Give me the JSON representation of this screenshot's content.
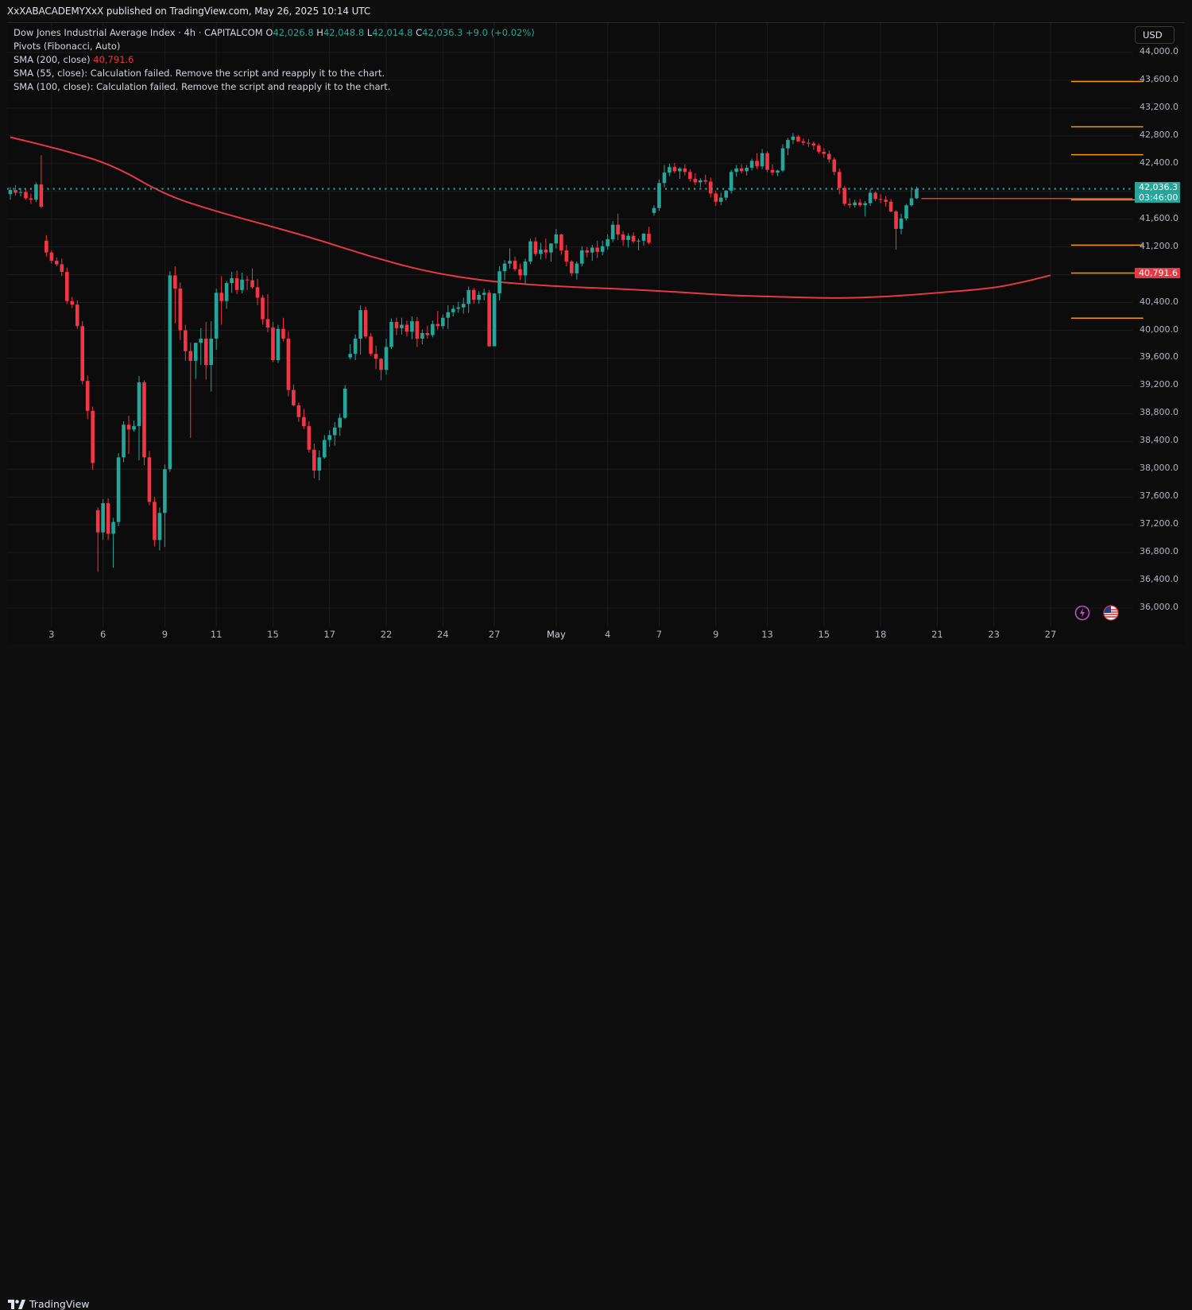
{
  "header": {
    "publish_line": "XxXABACADEMYXxX published on TradingView.com, May 26, 2025 10:14 UTC"
  },
  "legend": {
    "symbol_line": {
      "name": "Dow Jones Industrial Average Index · 4h · CAPITALCOM",
      "o_label": "O",
      "o": "42,026.8",
      "h_label": "H",
      "h": "42,048.8",
      "l_label": "L",
      "l": "42,014.8",
      "c_label": "C",
      "c": "42,036.3",
      "chg": "+9.0 (+0.02%)"
    },
    "pivots": "Pivots (Fibonacci, Auto)",
    "sma200_label": "SMA (200, close)",
    "sma200_value": "40,791.6",
    "sma55": "SMA (55, close): Calculation failed. Remove the script and reapply it to the chart.",
    "sma100": "SMA (100, close): Calculation failed. Remove the script and reapply it to the chart."
  },
  "currency_button": "USD",
  "price_tags": {
    "last": "42,036.3",
    "countdown": "03:46:00",
    "sma": "40,791.6"
  },
  "footer": {
    "brand": "TradingView"
  },
  "colors": {
    "up": "#26a69a",
    "down": "#f23645",
    "sma": "#e53946",
    "pivot": "#ff9800",
    "last_line": "#26a69a"
  },
  "chart_data": {
    "type": "candlestick",
    "title": "Dow Jones Industrial Average Index · 4h · CAPITALCOM",
    "ylim": [
      35750,
      44250
    ],
    "y_ticks": [
      "44,000.0",
      "43,600.0",
      "43,200.0",
      "42,800.0",
      "42,400.0",
      "42,000.0",
      "41,600.0",
      "41,200.0",
      "40,800.0",
      "40,400.0",
      "40,000.0",
      "39,600.0",
      "39,200.0",
      "38,800.0",
      "38,400.0",
      "38,000.0",
      "37,600.0",
      "37,200.0",
      "36,800.0",
      "36,400.0",
      "36,000.0"
    ],
    "y_tick_values": [
      44000,
      43600,
      43200,
      42800,
      42400,
      42000,
      41600,
      41200,
      40800,
      40400,
      40000,
      39600,
      39200,
      38800,
      38400,
      38000,
      37600,
      37200,
      36800,
      36400,
      36000
    ],
    "x_ticks": [
      "3",
      "6",
      "9",
      "11",
      "15",
      "17",
      "22",
      "24",
      "27",
      "May",
      "4",
      "7",
      "9",
      "13",
      "15",
      "18",
      "21",
      "23",
      "27"
    ],
    "x_tick_bars": [
      8,
      18,
      30,
      40,
      51,
      62,
      73,
      84,
      94,
      106,
      116,
      126,
      137,
      147,
      158,
      169,
      180,
      191,
      202
    ],
    "last_price": 42036.3,
    "sma200_last": 40791.6,
    "pivot_levels": [
      43582,
      42930,
      42528,
      41878,
      41226,
      40824,
      40174
    ],
    "sma200": [
      [
        0,
        42780
      ],
      [
        10,
        42600
      ],
      [
        20,
        42380
      ],
      [
        30,
        41950
      ],
      [
        40,
        41710
      ],
      [
        50,
        41510
      ],
      [
        60,
        41300
      ],
      [
        70,
        41060
      ],
      [
        80,
        40860
      ],
      [
        90,
        40730
      ],
      [
        100,
        40660
      ],
      [
        110,
        40620
      ],
      [
        120,
        40590
      ],
      [
        130,
        40550
      ],
      [
        140,
        40500
      ],
      [
        150,
        40480
      ],
      [
        160,
        40460
      ],
      [
        170,
        40480
      ],
      [
        180,
        40540
      ],
      [
        190,
        40600
      ],
      [
        196,
        40680
      ],
      [
        202,
        40791.6
      ]
    ],
    "candles": [
      [
        41960,
        42060,
        41880,
        42020
      ],
      [
        42020,
        42090,
        41940,
        41980
      ],
      [
        41980,
        42050,
        41930,
        41990
      ],
      [
        41990,
        42040,
        41880,
        41900
      ],
      [
        41900,
        41970,
        41820,
        41880
      ],
      [
        41880,
        42130,
        41850,
        42100
      ],
      [
        42100,
        42520,
        41760,
        41780
      ],
      [
        41290,
        41370,
        41060,
        41120
      ],
      [
        41120,
        41150,
        40960,
        41000
      ],
      [
        41000,
        41050,
        40920,
        40950
      ],
      [
        40950,
        41030,
        40780,
        40840
      ],
      [
        40840,
        40900,
        40380,
        40420
      ],
      [
        40420,
        40480,
        40320,
        40370
      ],
      [
        40370,
        40430,
        40020,
        40060
      ],
      [
        40060,
        40130,
        39220,
        39270
      ],
      [
        39270,
        39350,
        38720,
        38840
      ],
      [
        38840,
        38900,
        37990,
        38090
      ],
      [
        37410,
        37450,
        36520,
        37090
      ],
      [
        37090,
        37570,
        36980,
        37510
      ],
      [
        37510,
        37580,
        36980,
        37070
      ],
      [
        37070,
        37300,
        36580,
        37240
      ],
      [
        37240,
        38230,
        37180,
        38170
      ],
      [
        38170,
        38690,
        38100,
        38640
      ],
      [
        38640,
        38770,
        38220,
        38570
      ],
      [
        38570,
        38700,
        38540,
        38620
      ],
      [
        38620,
        39340,
        38130,
        39250
      ],
      [
        39250,
        39280,
        38060,
        38170
      ],
      [
        38170,
        38260,
        37480,
        37530
      ],
      [
        37530,
        37600,
        36890,
        36980
      ],
      [
        36980,
        37450,
        36830,
        37370
      ],
      [
        37370,
        38070,
        36880,
        38000
      ],
      [
        38000,
        40850,
        37960,
        40790
      ],
      [
        40790,
        40920,
        40100,
        40600
      ],
      [
        40600,
        40690,
        39860,
        40000
      ],
      [
        40000,
        40080,
        39560,
        39700
      ],
      [
        39700,
        39820,
        38450,
        39560
      ],
      [
        39560,
        39810,
        39300,
        39820
      ],
      [
        39820,
        40030,
        39500,
        39880
      ],
      [
        39880,
        40120,
        39290,
        39500
      ],
      [
        39500,
        40130,
        39120,
        39880
      ],
      [
        39880,
        40600,
        39720,
        40540
      ],
      [
        40540,
        40780,
        40080,
        40420
      ],
      [
        40420,
        40710,
        40310,
        40680
      ],
      [
        40680,
        40840,
        40540,
        40750
      ],
      [
        40750,
        40860,
        40520,
        40580
      ],
      [
        40580,
        40830,
        40530,
        40730
      ],
      [
        40730,
        40780,
        40580,
        40720
      ],
      [
        40720,
        40890,
        40600,
        40620
      ],
      [
        40620,
        40740,
        40360,
        40470
      ],
      [
        40470,
        40510,
        40080,
        40160
      ],
      [
        40160,
        40520,
        39970,
        40040
      ],
      [
        40040,
        40120,
        39540,
        39570
      ],
      [
        39570,
        40080,
        39530,
        40020
      ],
      [
        40020,
        40180,
        39840,
        39880
      ],
      [
        39880,
        39990,
        39050,
        39140
      ],
      [
        39140,
        39220,
        38910,
        38920
      ],
      [
        38920,
        38960,
        38680,
        38750
      ],
      [
        38750,
        38870,
        38580,
        38620
      ],
      [
        38620,
        38690,
        38240,
        38280
      ],
      [
        38280,
        38370,
        37870,
        37980
      ],
      [
        37980,
        38270,
        37840,
        38170
      ],
      [
        38170,
        38490,
        38150,
        38420
      ],
      [
        38420,
        38560,
        38320,
        38490
      ],
      [
        38490,
        38680,
        38340,
        38600
      ],
      [
        38600,
        38800,
        38480,
        38740
      ],
      [
        38740,
        39210,
        38720,
        39160
      ],
      [
        39610,
        39800,
        39580,
        39660
      ],
      [
        39660,
        39940,
        39570,
        39880
      ],
      [
        39880,
        40360,
        39650,
        40290
      ],
      [
        40290,
        40340,
        39880,
        39910
      ],
      [
        39910,
        39960,
        39630,
        39660
      ],
      [
        39660,
        39780,
        39440,
        39590
      ],
      [
        39590,
        39600,
        39280,
        39430
      ],
      [
        39430,
        39880,
        39360,
        39760
      ],
      [
        39760,
        40170,
        39730,
        40120
      ],
      [
        40120,
        40180,
        39930,
        40030
      ],
      [
        40030,
        40180,
        39940,
        40080
      ],
      [
        40080,
        40140,
        39910,
        39980
      ],
      [
        39980,
        40200,
        39870,
        40130
      ],
      [
        40130,
        40190,
        39760,
        39880
      ],
      [
        39880,
        40010,
        39800,
        39960
      ],
      [
        39960,
        40070,
        39880,
        39930
      ],
      [
        39930,
        40140,
        39900,
        40090
      ],
      [
        40090,
        40280,
        40010,
        40060
      ],
      [
        40060,
        40230,
        40020,
        40180
      ],
      [
        40180,
        40360,
        40020,
        40260
      ],
      [
        40260,
        40360,
        40200,
        40310
      ],
      [
        40310,
        40410,
        40250,
        40330
      ],
      [
        40330,
        40470,
        40240,
        40380
      ],
      [
        40380,
        40630,
        40250,
        40580
      ],
      [
        40580,
        40610,
        40380,
        40440
      ],
      [
        40440,
        40560,
        40380,
        40510
      ],
      [
        40510,
        40600,
        40430,
        40540
      ],
      [
        40540,
        40580,
        39760,
        39770
      ],
      [
        39770,
        40530,
        39770,
        40530
      ],
      [
        40530,
        40920,
        40430,
        40850
      ],
      [
        40850,
        41010,
        40720,
        40960
      ],
      [
        40960,
        41180,
        40890,
        41000
      ],
      [
        41000,
        41060,
        40850,
        40880
      ],
      [
        40880,
        40960,
        40720,
        40790
      ],
      [
        40790,
        41030,
        40660,
        40990
      ],
      [
        40990,
        41320,
        40950,
        41280
      ],
      [
        41280,
        41340,
        41070,
        41100
      ],
      [
        41100,
        41260,
        41020,
        41160
      ],
      [
        41160,
        41320,
        41030,
        41120
      ],
      [
        41120,
        41220,
        40990,
        41250
      ],
      [
        41250,
        41460,
        41180,
        41380
      ],
      [
        41380,
        41390,
        41090,
        41150
      ],
      [
        41150,
        41230,
        40920,
        40990
      ],
      [
        40990,
        41010,
        40780,
        40820
      ],
      [
        40820,
        40990,
        40730,
        40960
      ],
      [
        40960,
        41210,
        40920,
        41150
      ],
      [
        41150,
        41200,
        41050,
        41120
      ],
      [
        41120,
        41230,
        41000,
        41190
      ],
      [
        41190,
        41290,
        41040,
        41130
      ],
      [
        41130,
        41290,
        41080,
        41210
      ],
      [
        41210,
        41380,
        41160,
        41310
      ],
      [
        41310,
        41570,
        41270,
        41520
      ],
      [
        41520,
        41680,
        41300,
        41380
      ],
      [
        41380,
        41430,
        41220,
        41300
      ],
      [
        41300,
        41400,
        41190,
        41360
      ],
      [
        41360,
        41410,
        41250,
        41280
      ],
      [
        41280,
        41320,
        41150,
        41290
      ],
      [
        41290,
        41400,
        41220,
        41390
      ],
      [
        41390,
        41490,
        41240,
        41260
      ],
      [
        41690,
        41800,
        41650,
        41760
      ],
      [
        41760,
        42170,
        41720,
        42120
      ],
      [
        42120,
        42380,
        42060,
        42270
      ],
      [
        42270,
        42400,
        42220,
        42350
      ],
      [
        42350,
        42410,
        42260,
        42290
      ],
      [
        42290,
        42350,
        42180,
        42330
      ],
      [
        42330,
        42390,
        42230,
        42280
      ],
      [
        42280,
        42320,
        42140,
        42180
      ],
      [
        42180,
        42260,
        42090,
        42130
      ],
      [
        42130,
        42190,
        42060,
        42160
      ],
      [
        42160,
        42240,
        42100,
        42140
      ],
      [
        42140,
        42200,
        41910,
        41970
      ],
      [
        41970,
        42010,
        41790,
        41850
      ],
      [
        41850,
        41980,
        41800,
        41910
      ],
      [
        41910,
        42020,
        41870,
        42010
      ],
      [
        42010,
        42310,
        41970,
        42280
      ],
      [
        42280,
        42380,
        42210,
        42330
      ],
      [
        42330,
        42390,
        42260,
        42290
      ],
      [
        42290,
        42380,
        42230,
        42340
      ],
      [
        42340,
        42470,
        42300,
        42440
      ],
      [
        42440,
        42550,
        42320,
        42360
      ],
      [
        42360,
        42610,
        42320,
        42550
      ],
      [
        42550,
        42580,
        42280,
        42310
      ],
      [
        42310,
        42390,
        42230,
        42270
      ],
      [
        42270,
        42310,
        42220,
        42300
      ],
      [
        42300,
        42680,
        42280,
        42620
      ],
      [
        42620,
        42770,
        42520,
        42740
      ],
      [
        42740,
        42840,
        42680,
        42790
      ],
      [
        42790,
        42810,
        42710,
        42720
      ],
      [
        42720,
        42760,
        42660,
        42700
      ],
      [
        42700,
        42750,
        42640,
        42690
      ],
      [
        42690,
        42720,
        42600,
        42660
      ],
      [
        42660,
        42690,
        42540,
        42570
      ],
      [
        42570,
        42620,
        42480,
        42540
      ],
      [
        42540,
        42590,
        42410,
        42460
      ],
      [
        42460,
        42490,
        42230,
        42280
      ],
      [
        42280,
        42330,
        41960,
        42050
      ],
      [
        42050,
        42080,
        41790,
        41820
      ],
      [
        41820,
        41900,
        41760,
        41800
      ],
      [
        41800,
        41880,
        41770,
        41840
      ],
      [
        41840,
        41890,
        41780,
        41800
      ],
      [
        41800,
        41860,
        41640,
        41830
      ],
      [
        41830,
        42040,
        41790,
        41980
      ],
      [
        41980,
        42000,
        41860,
        41890
      ],
      [
        41890,
        41960,
        41830,
        41880
      ],
      [
        41880,
        41930,
        41780,
        41850
      ],
      [
        41850,
        41890,
        41700,
        41710
      ],
      [
        41710,
        41730,
        41160,
        41460
      ],
      [
        41460,
        41680,
        41380,
        41610
      ],
      [
        41610,
        41820,
        41580,
        41800
      ],
      [
        41800,
        42060,
        41780,
        41900
      ],
      [
        41900,
        42070,
        41890,
        42036
      ]
    ]
  }
}
